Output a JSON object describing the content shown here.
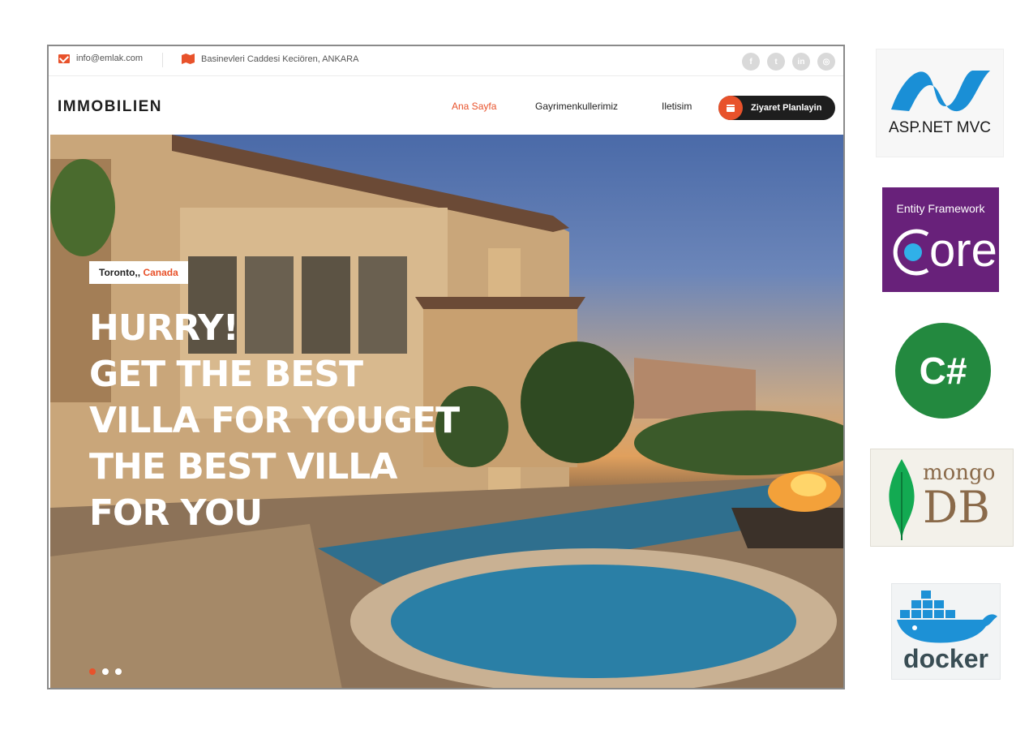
{
  "topbar": {
    "email": "info@emlak.com",
    "address": "Basinevleri Caddesi Keciören, ANKARA",
    "socials": [
      {
        "icon": "facebook-icon",
        "glyph": "f"
      },
      {
        "icon": "twitter-icon",
        "glyph": "t"
      },
      {
        "icon": "linkedin-icon",
        "glyph": "in"
      },
      {
        "icon": "instagram-icon",
        "glyph": "◎"
      }
    ]
  },
  "nav": {
    "brand": "IMMOBILIEN",
    "links": [
      "Ana Sayfa",
      "Gayrimenkullerimiz",
      "Iletisim"
    ],
    "active_link": "Ana Sayfa",
    "cta_label": "Ziyaret Planlayin"
  },
  "hero": {
    "location_prefix": "Toronto,,",
    "location_city": "Canada",
    "title_lines": [
      "HURRY!",
      "GET THE BEST",
      "VILLA FOR YOUGET",
      "THE BEST VILLA",
      "FOR YOU"
    ],
    "slides": 3,
    "active_slide": 1
  },
  "side_logos": {
    "aspnet": "ASP.NET MVC",
    "efcore_top": "Entity Framework",
    "efcore_word": "ore",
    "csharp": "C#",
    "mongo_top": "mongo",
    "mongo_bottom": "DB",
    "docker": "docker"
  },
  "colors": {
    "accent": "#e8522b",
    "dark": "#1e1e1e"
  }
}
